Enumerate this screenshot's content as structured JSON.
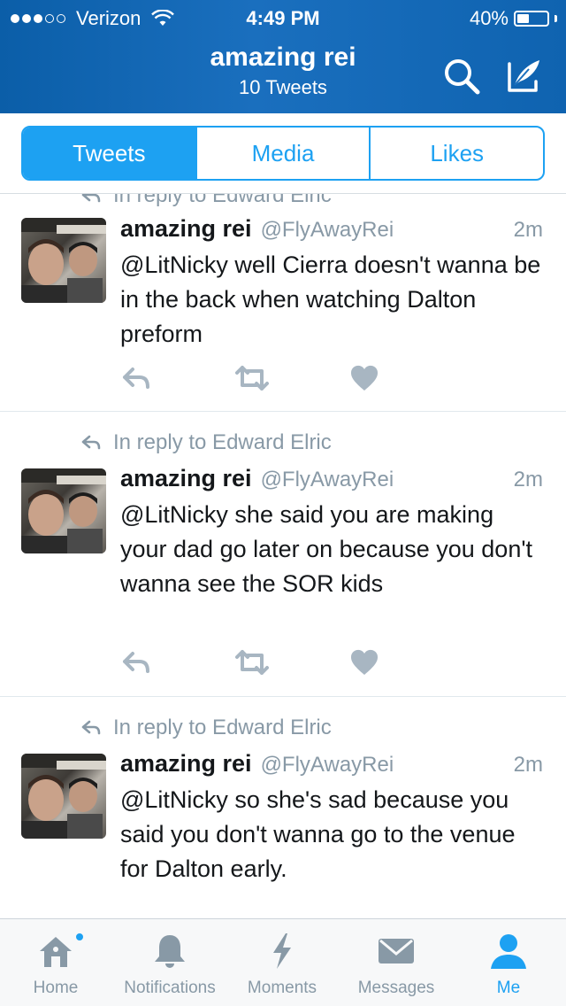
{
  "status_bar": {
    "carrier": "Verizon",
    "time": "4:49 PM",
    "battery_percent_label": "40%",
    "battery_level": 0.4,
    "signal_bars_filled": 3,
    "signal_bars_total": 5
  },
  "header": {
    "title": "amazing rei",
    "subtitle": "10 Tweets",
    "search_icon": "search-icon",
    "compose_icon": "compose-icon"
  },
  "segments": {
    "tweets": "Tweets",
    "media": "Media",
    "likes": "Likes",
    "active": "Tweets"
  },
  "tweets": [
    {
      "reply_to": "In reply to Edward Elric",
      "name": "amazing rei",
      "handle": "@FlyAwayRei",
      "time": "2m",
      "text": "@LitNicky well Cierra doesn't wanna be in the back when watching Dalton preform"
    },
    {
      "reply_to": "In reply to Edward Elric",
      "name": "amazing rei",
      "handle": "@FlyAwayRei",
      "time": "2m",
      "text": "@LitNicky she said you are making your dad go later on because you don't wanna see the SOR kids"
    },
    {
      "reply_to": "In reply to Edward Elric",
      "name": "amazing rei",
      "handle": "@FlyAwayRei",
      "time": "2m",
      "text": "@LitNicky so she's sad because you said you don't wanna go to the venue for Dalton early."
    }
  ],
  "tabbar": {
    "home": "Home",
    "notifications": "Notifications",
    "moments": "Moments",
    "messages": "Messages",
    "me": "Me",
    "active": "Me"
  },
  "colors": {
    "header_blue": "#1a6fbe",
    "accent": "#1da1f2",
    "secondary_text": "#8899a6",
    "action_icon": "#a8b6c2"
  }
}
